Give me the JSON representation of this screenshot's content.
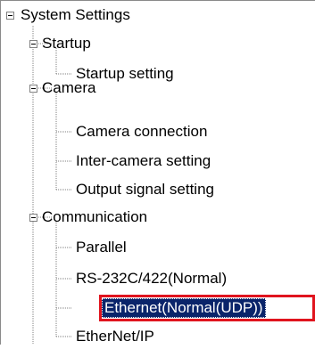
{
  "tree": {
    "root": {
      "label": "System Settings",
      "expanded": true
    },
    "groups": [
      {
        "label": "Startup",
        "expanded": true,
        "children": [
          "Startup setting"
        ]
      },
      {
        "label": "Camera",
        "expanded": true,
        "children": [
          "Camera connection",
          "Inter-camera setting",
          "Output signal setting"
        ]
      },
      {
        "label": "Communication",
        "expanded": true,
        "children": [
          "Parallel",
          "RS-232C/422(Normal)",
          "Ethernet(Normal(UDP))",
          "EtherNet/IP"
        ]
      }
    ],
    "selected": "Ethernet(Normal(UDP))"
  },
  "colors": {
    "selection_bg": "#0a246a",
    "selection_fg": "#ffffff",
    "highlight_border": "#e0141e",
    "connector_lines": "#808080"
  },
  "icons": {
    "expander": "minus-box-icon"
  }
}
